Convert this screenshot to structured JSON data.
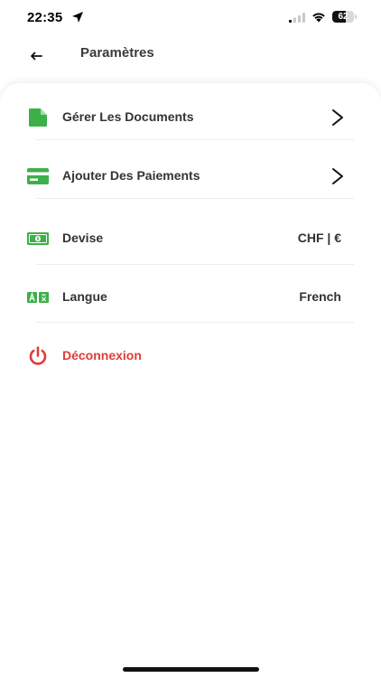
{
  "status_bar": {
    "time": "22:35",
    "battery_level": "62",
    "battery_fraction": 0.62
  },
  "header": {
    "title": "Paramètres",
    "back_icon": "back-arrow-icon"
  },
  "colors": {
    "accent_green": "#3db04a",
    "danger_red": "#e03b3b",
    "text": "#333333",
    "divider": "#ececec"
  },
  "menu": {
    "documents": {
      "label": "Gérer Les Documents",
      "icon": "document-icon"
    },
    "payments": {
      "label": "Ajouter Des Paiements",
      "icon": "credit-card-icon"
    },
    "currency": {
      "label": "Devise",
      "value": "CHF | €",
      "icon": "banknote-icon"
    },
    "language": {
      "label": "Langue",
      "value": "French",
      "icon": "translate-icon"
    },
    "logout": {
      "label": "Déconnexion",
      "icon": "power-icon"
    }
  }
}
